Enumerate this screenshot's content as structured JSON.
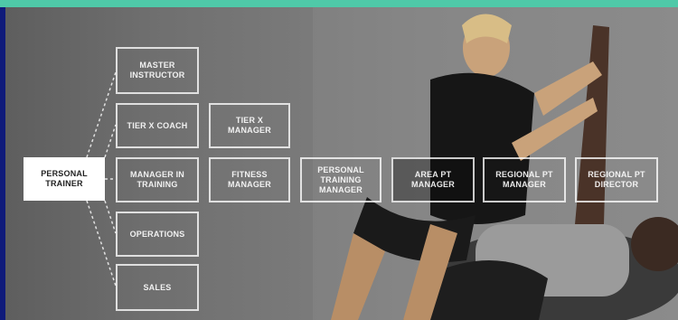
{
  "colors": {
    "top_bar": "#4fc9a8",
    "left_bar": "#0f1a7a",
    "box_border": "#ffffff",
    "root_fill": "#ffffff"
  },
  "diagram": {
    "root": "PERSONAL\nTRAINER",
    "branches": {
      "master_instructor": "MASTER\nINSTRUCTOR",
      "tier_x_coach": "TIER X COACH",
      "manager_in_training": "MANAGER IN\nTRAINING",
      "operations": "OPERATIONS",
      "sales": "SALES"
    },
    "tier_x_manager": "TIER X\nMANAGER",
    "career_path": {
      "fitness_manager": "FITNESS\nMANAGER",
      "personal_training_manager": "PERSONAL\nTRAINING\nMANAGER",
      "area_pt_manager": "AREA PT\nMANAGER",
      "regional_pt_manager": "REGIONAL PT\nMANAGER",
      "regional_pt_director": "REGIONAL PT\nDIRECTOR"
    }
  }
}
